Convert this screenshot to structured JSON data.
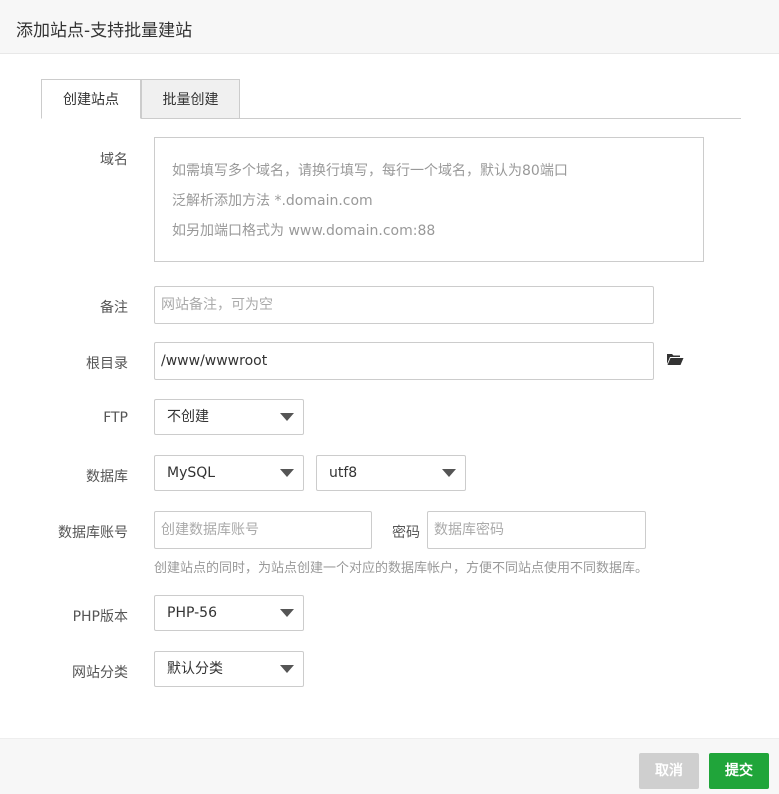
{
  "dialog": {
    "title": "添加站点-支持批量建站"
  },
  "tabs": [
    {
      "label": "创建站点"
    },
    {
      "label": "批量创建"
    }
  ],
  "form": {
    "domain": {
      "label": "域名",
      "placeholder_lines": [
        "如需填写多个域名，请换行填写，每行一个域名，默认为80端口",
        "泛解析添加方法 *.domain.com",
        "如另加端口格式为 www.domain.com:88"
      ]
    },
    "remark": {
      "label": "备注",
      "placeholder": "网站备注，可为空"
    },
    "root": {
      "label": "根目录",
      "value": "/www/wwwroot",
      "icon": "folder-open-icon"
    },
    "ftp": {
      "label": "FTP",
      "selected": "不创建"
    },
    "database": {
      "label": "数据库",
      "type_selected": "MySQL",
      "charset_selected": "utf8"
    },
    "db_account": {
      "label": "数据库账号",
      "account_placeholder": "创建数据库账号",
      "password_label": "密码",
      "password_placeholder": "数据库密码",
      "hint": "创建站点的同时，为站点创建一个对应的数据库帐户，方便不同站点使用不同数据库。"
    },
    "php": {
      "label": "PHP版本",
      "selected": "PHP-56"
    },
    "category": {
      "label": "网站分类",
      "selected": "默认分类"
    }
  },
  "footer": {
    "cancel_label": "取消",
    "submit_label": "提交"
  },
  "colors": {
    "submit": "#20a53a",
    "cancel": "#cfcfcf",
    "border": "#cccccc"
  }
}
